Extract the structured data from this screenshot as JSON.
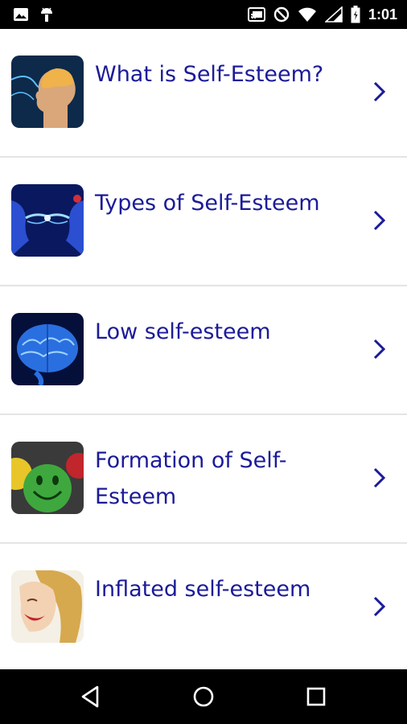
{
  "status_bar": {
    "time": "1:01",
    "icons": [
      "image-notification-icon",
      "android-debug-icon",
      "cast-icon",
      "do-not-disturb-icon",
      "wifi-icon",
      "signal-icon",
      "battery-icon"
    ]
  },
  "topics": [
    {
      "title": "What is Self-Esteem?",
      "icon": "brain-head-profile-thumbnail"
    },
    {
      "title": "Types of Self-Esteem",
      "icon": "two-faces-energy-thumbnail"
    },
    {
      "title": "Low self-esteem",
      "icon": "blue-brain-thumbnail"
    },
    {
      "title": "Formation of Self-Esteem",
      "icon": "smiley-faces-thumbnail"
    },
    {
      "title": "Inflated self-esteem",
      "icon": "laughing-woman-thumbnail"
    }
  ],
  "colors": {
    "title_text": "#1b1b99",
    "chevron": "#1b1b99",
    "divider": "#e4e4e4",
    "bars": "#000000"
  },
  "nav_bar": {
    "buttons": [
      "back-button",
      "home-button",
      "recents-button"
    ]
  }
}
